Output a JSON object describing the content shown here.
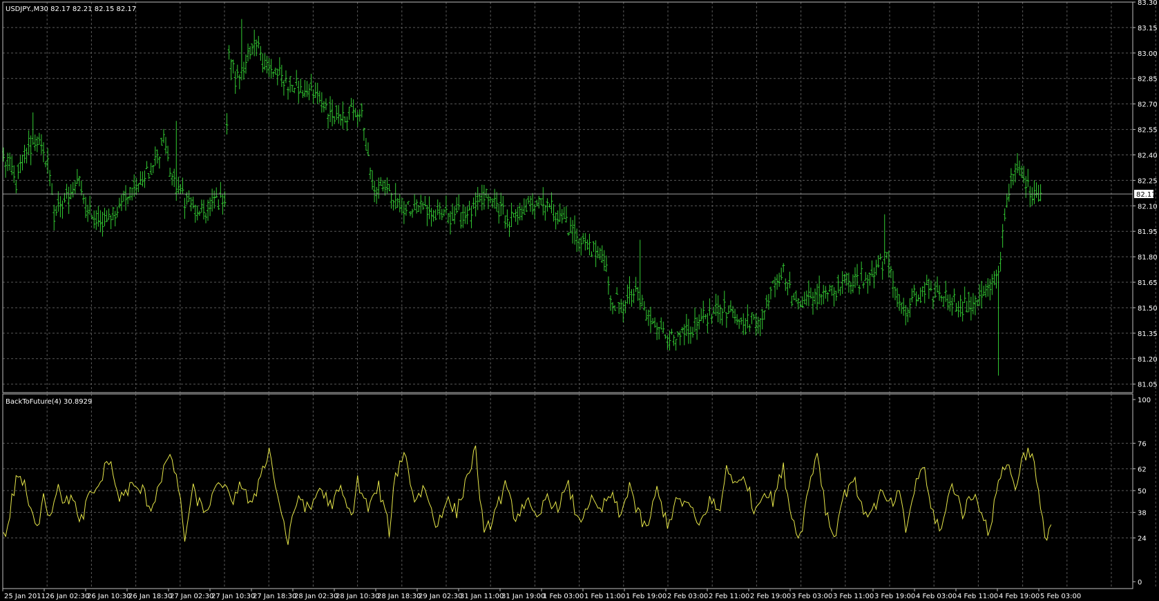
{
  "window": {
    "symbol_info": "USDJPY.,M30  82.17 82.21 82.15 82.17"
  },
  "colors": {
    "background": "#000000",
    "grid": "#5a5a5a",
    "axis": "#c0c0c0",
    "bars": "#33cc33",
    "indicator_line": "#e8e84a",
    "indicator_low": "#33cc33",
    "price_line": "#a0a0a0",
    "text": "#ffffff"
  },
  "chart_data": [
    {
      "type": "ohlc",
      "title": "USDJPY.,M30",
      "ohlc_readout": "82.17 82.21 82.15 82.17",
      "current_price": "82.17",
      "ylim": [
        81.0,
        83.3
      ],
      "yticks": [
        "83.30",
        "83.15",
        "83.00",
        "82.85",
        "82.70",
        "82.55",
        "82.40",
        "82.25",
        "82.10",
        "81.95",
        "81.80",
        "81.65",
        "81.50",
        "81.35",
        "81.20",
        "81.05"
      ],
      "anchors": [
        [
          0,
          82.4
        ],
        [
          6,
          82.25
        ],
        [
          12,
          82.45
        ],
        [
          16,
          82.5
        ],
        [
          21,
          82.35
        ],
        [
          24,
          82.05
        ],
        [
          28,
          82.1
        ],
        [
          35,
          82.25
        ],
        [
          40,
          82.05
        ],
        [
          45,
          82.0
        ],
        [
          52,
          82.05
        ],
        [
          60,
          82.2
        ],
        [
          70,
          82.3
        ],
        [
          76,
          82.5
        ],
        [
          80,
          82.25
        ],
        [
          86,
          82.15
        ],
        [
          92,
          82.05
        ],
        [
          98,
          82.1
        ],
        [
          105,
          82.15
        ],
        [
          107,
          83.0
        ],
        [
          110,
          82.85
        ],
        [
          115,
          82.95
        ],
        [
          120,
          83.05
        ],
        [
          126,
          82.9
        ],
        [
          132,
          82.85
        ],
        [
          140,
          82.8
        ],
        [
          148,
          82.75
        ],
        [
          155,
          82.65
        ],
        [
          162,
          82.65
        ],
        [
          170,
          82.65
        ],
        [
          175,
          82.2
        ],
        [
          182,
          82.2
        ],
        [
          188,
          82.1
        ],
        [
          195,
          82.1
        ],
        [
          205,
          82.05
        ],
        [
          215,
          82.05
        ],
        [
          222,
          82.05
        ],
        [
          228,
          82.15
        ],
        [
          235,
          82.1
        ],
        [
          240,
          82.0
        ],
        [
          248,
          82.1
        ],
        [
          258,
          82.1
        ],
        [
          265,
          82.05
        ],
        [
          270,
          81.95
        ],
        [
          278,
          81.85
        ],
        [
          285,
          81.8
        ],
        [
          288,
          81.55
        ],
        [
          293,
          81.5
        ],
        [
          300,
          81.6
        ],
        [
          305,
          81.45
        ],
        [
          310,
          81.4
        ],
        [
          318,
          81.3
        ],
        [
          325,
          81.35
        ],
        [
          333,
          81.45
        ],
        [
          340,
          81.5
        ],
        [
          346,
          81.45
        ],
        [
          353,
          81.4
        ],
        [
          360,
          81.45
        ],
        [
          365,
          81.65
        ],
        [
          370,
          81.7
        ],
        [
          375,
          81.55
        ],
        [
          382,
          81.55
        ],
        [
          390,
          81.6
        ],
        [
          398,
          81.65
        ],
        [
          405,
          81.65
        ],
        [
          412,
          81.7
        ],
        [
          418,
          81.8
        ],
        [
          422,
          81.65
        ],
        [
          428,
          81.45
        ],
        [
          432,
          81.55
        ],
        [
          440,
          81.6
        ],
        [
          448,
          81.55
        ],
        [
          455,
          81.5
        ],
        [
          462,
          81.55
        ],
        [
          468,
          81.6
        ],
        [
          472,
          81.7
        ],
        [
          475,
          82.05
        ],
        [
          478,
          82.25
        ],
        [
          482,
          82.3
        ],
        [
          486,
          82.2
        ],
        [
          490,
          82.17
        ]
      ],
      "spikes": [
        [
          14,
          82.65,
          "h"
        ],
        [
          82,
          82.6,
          "h"
        ],
        [
          113,
          83.2,
          "h"
        ],
        [
          302,
          81.9,
          "h"
        ],
        [
          418,
          82.05,
          "h"
        ],
        [
          472,
          81.1,
          "l"
        ]
      ]
    },
    {
      "type": "line",
      "title": "BackToFuture(4) 30.8929",
      "indicator_name": "BackToFuture(4)",
      "last_value": "30.8929",
      "ylim": [
        0,
        100
      ],
      "yticks": [
        "100",
        "76",
        "62",
        "50",
        "38",
        "24",
        "0"
      ],
      "gridlines": [
        76,
        62,
        50,
        38,
        24
      ],
      "peaks": [
        [
          0,
          28
        ],
        [
          1,
          24
        ],
        [
          4,
          45
        ],
        [
          7,
          60
        ],
        [
          10,
          52
        ],
        [
          13,
          38
        ],
        [
          16,
          28
        ],
        [
          19,
          50
        ],
        [
          22,
          35
        ],
        [
          26,
          55
        ],
        [
          29,
          42
        ],
        [
          33,
          48
        ],
        [
          36,
          30
        ],
        [
          40,
          45
        ],
        [
          45,
          52
        ],
        [
          50,
          68
        ],
        [
          55,
          45
        ],
        [
          60,
          52
        ],
        [
          66,
          50
        ],
        [
          70,
          40
        ],
        [
          75,
          58
        ],
        [
          78,
          68
        ],
        [
          82,
          60
        ],
        [
          86,
          24
        ],
        [
          90,
          50
        ],
        [
          95,
          38
        ],
        [
          100,
          48
        ],
        [
          104,
          55
        ],
        [
          108,
          42
        ],
        [
          112,
          55
        ],
        [
          118,
          40
        ],
        [
          122,
          60
        ],
        [
          126,
          72
        ],
        [
          131,
          42
        ],
        [
          135,
          22
        ],
        [
          140,
          48
        ],
        [
          145,
          38
        ],
        [
          150,
          52
        ],
        [
          155,
          42
        ],
        [
          160,
          50
        ],
        [
          165,
          35
        ],
        [
          168,
          55
        ],
        [
          173,
          40
        ],
        [
          178,
          52
        ],
        [
          183,
          28
        ],
        [
          186,
          58
        ],
        [
          190,
          72
        ],
        [
          195,
          45
        ],
        [
          200,
          52
        ],
        [
          205,
          30
        ],
        [
          210,
          45
        ],
        [
          215,
          38
        ],
        [
          220,
          58
        ],
        [
          224,
          72
        ],
        [
          228,
          24
        ],
        [
          233,
          38
        ],
        [
          238,
          52
        ],
        [
          243,
          35
        ],
        [
          248,
          45
        ],
        [
          253,
          32
        ],
        [
          258,
          48
        ],
        [
          262,
          40
        ],
        [
          268,
          52
        ],
        [
          273,
          32
        ],
        [
          278,
          45
        ],
        [
          283,
          38
        ],
        [
          288,
          48
        ],
        [
          293,
          35
        ],
        [
          297,
          55
        ],
        [
          300,
          40
        ],
        [
          305,
          28
        ],
        [
          310,
          50
        ],
        [
          315,
          32
        ],
        [
          320,
          45
        ],
        [
          325,
          42
        ],
        [
          330,
          30
        ],
        [
          335,
          45
        ],
        [
          340,
          38
        ],
        [
          343,
          64
        ],
        [
          348,
          52
        ],
        [
          352,
          58
        ],
        [
          356,
          38
        ],
        [
          360,
          50
        ],
        [
          365,
          45
        ],
        [
          370,
          62
        ],
        [
          374,
          35
        ],
        [
          378,
          25
        ],
        [
          382,
          52
        ],
        [
          386,
          72
        ],
        [
          390,
          40
        ],
        [
          394,
          24
        ],
        [
          398,
          45
        ],
        [
          403,
          58
        ],
        [
          407,
          40
        ],
        [
          412,
          38
        ],
        [
          416,
          48
        ],
        [
          421,
          42
        ],
        [
          425,
          48
        ],
        [
          428,
          28
        ],
        [
          432,
          50
        ],
        [
          436,
          65
        ],
        [
          440,
          40
        ],
        [
          445,
          28
        ],
        [
          450,
          55
        ],
        [
          455,
          38
        ],
        [
          460,
          48
        ],
        [
          464,
          40
        ],
        [
          468,
          25
        ],
        [
          472,
          58
        ],
        [
          476,
          65
        ],
        [
          480,
          52
        ],
        [
          484,
          70
        ],
        [
          488,
          72
        ],
        [
          490,
          55
        ],
        [
          494,
          24
        ],
        [
          497,
          32
        ]
      ]
    }
  ],
  "x_axis": {
    "labels": [
      "25 Jan 2011",
      "26 Jan 02:30",
      "26 Jan 10:30",
      "26 Jan 18:30",
      "27 Jan 02:30",
      "27 Jan 10:30",
      "27 Jan 18:30",
      "28 Jan 02:30",
      "28 Jan 10:30",
      "28 Jan 18:30",
      "29 Jan 02:30",
      "31 Jan 11:00",
      "31 Jan 19:00",
      "1 Feb 03:00",
      "1 Feb 11:00",
      "1 Feb 19:00",
      "2 Feb 03:00",
      "2 Feb 11:00",
      "2 Feb 19:00",
      "3 Feb 03:00",
      "3 Feb 11:00",
      "3 Feb 19:00",
      "4 Feb 03:00",
      "4 Feb 11:00",
      "4 Feb 19:00",
      "5 Feb 03:00"
    ]
  }
}
